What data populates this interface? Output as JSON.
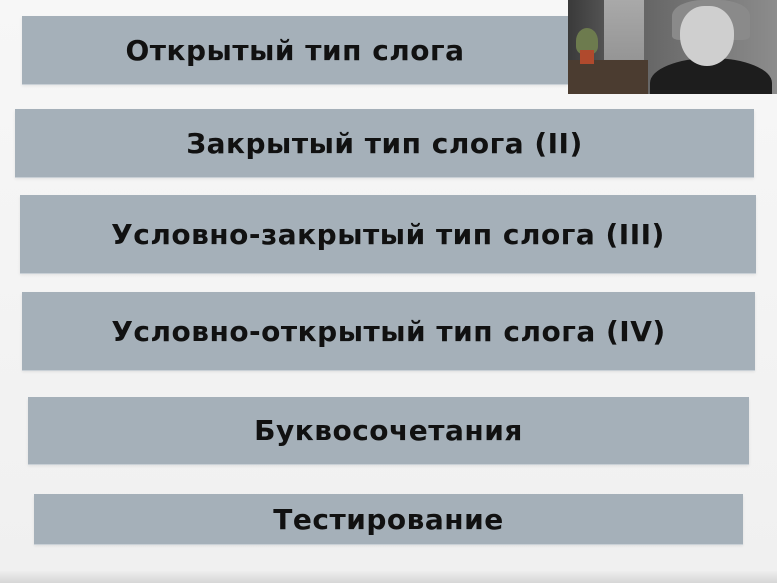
{
  "menu": {
    "items": [
      {
        "label": "Открытый тип слога"
      },
      {
        "label": "Закрытый тип слога (II)"
      },
      {
        "label": "Условно-закрытый тип слога (III)"
      },
      {
        "label": "Условно-открытый тип слога (IV)"
      },
      {
        "label": "Буквосочетания"
      },
      {
        "label": "Тестирование"
      }
    ]
  },
  "colors": {
    "bar": "#a5b0b9",
    "background": "#f3f3f3",
    "text": "#111111"
  }
}
